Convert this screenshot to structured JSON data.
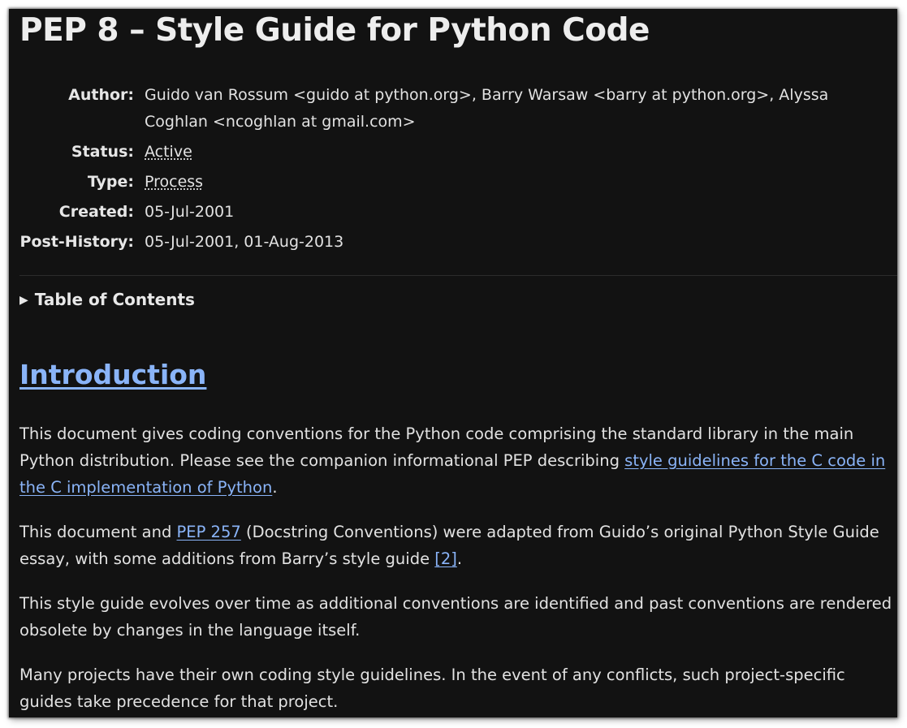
{
  "document": {
    "title": "PEP 8 – Style Guide for Python Code"
  },
  "metadata": {
    "author_label": "Author:",
    "author_value": "Guido van Rossum <guido at python.org>, Barry Warsaw <barry at python.org>, Alyssa Coghlan <ncoghlan at gmail.com>",
    "status_label": "Status:",
    "status_value": "Active",
    "type_label": "Type:",
    "type_value": "Process",
    "created_label": "Created:",
    "created_value": "05-Jul-2001",
    "post_history_label": "Post-History:",
    "post_history_value": "05-Jul-2001, 01-Aug-2013"
  },
  "toc": {
    "marker": "▶",
    "label": "Table of Contents"
  },
  "introduction": {
    "heading": "Introduction",
    "p1_text": "This document gives coding conventions for the Python code comprising the standard library in the main Python distribution. Please see the companion informational PEP describing ",
    "p1_link": "style guidelines for the C code in the C implementation of Python",
    "p1_end": ".",
    "p2_start": "This document and ",
    "p2_link": "PEP 257",
    "p2_middle": " (Docstring Conventions) were adapted from Guido’s original Python Style Guide essay, with some additions from Barry’s style guide ",
    "p2_ref": "[2]",
    "p2_end": ".",
    "p3": "This style guide evolves over time as additional conventions are identified and past conventions are rendered obsolete by changes in the language itself.",
    "p4": "Many projects have their own coding style guidelines. In the event of any conflicts, such project-specific guides take precedence for that project."
  },
  "colors": {
    "background": "#121212",
    "text": "#e2e2e2",
    "link": "#8ab4f8"
  }
}
